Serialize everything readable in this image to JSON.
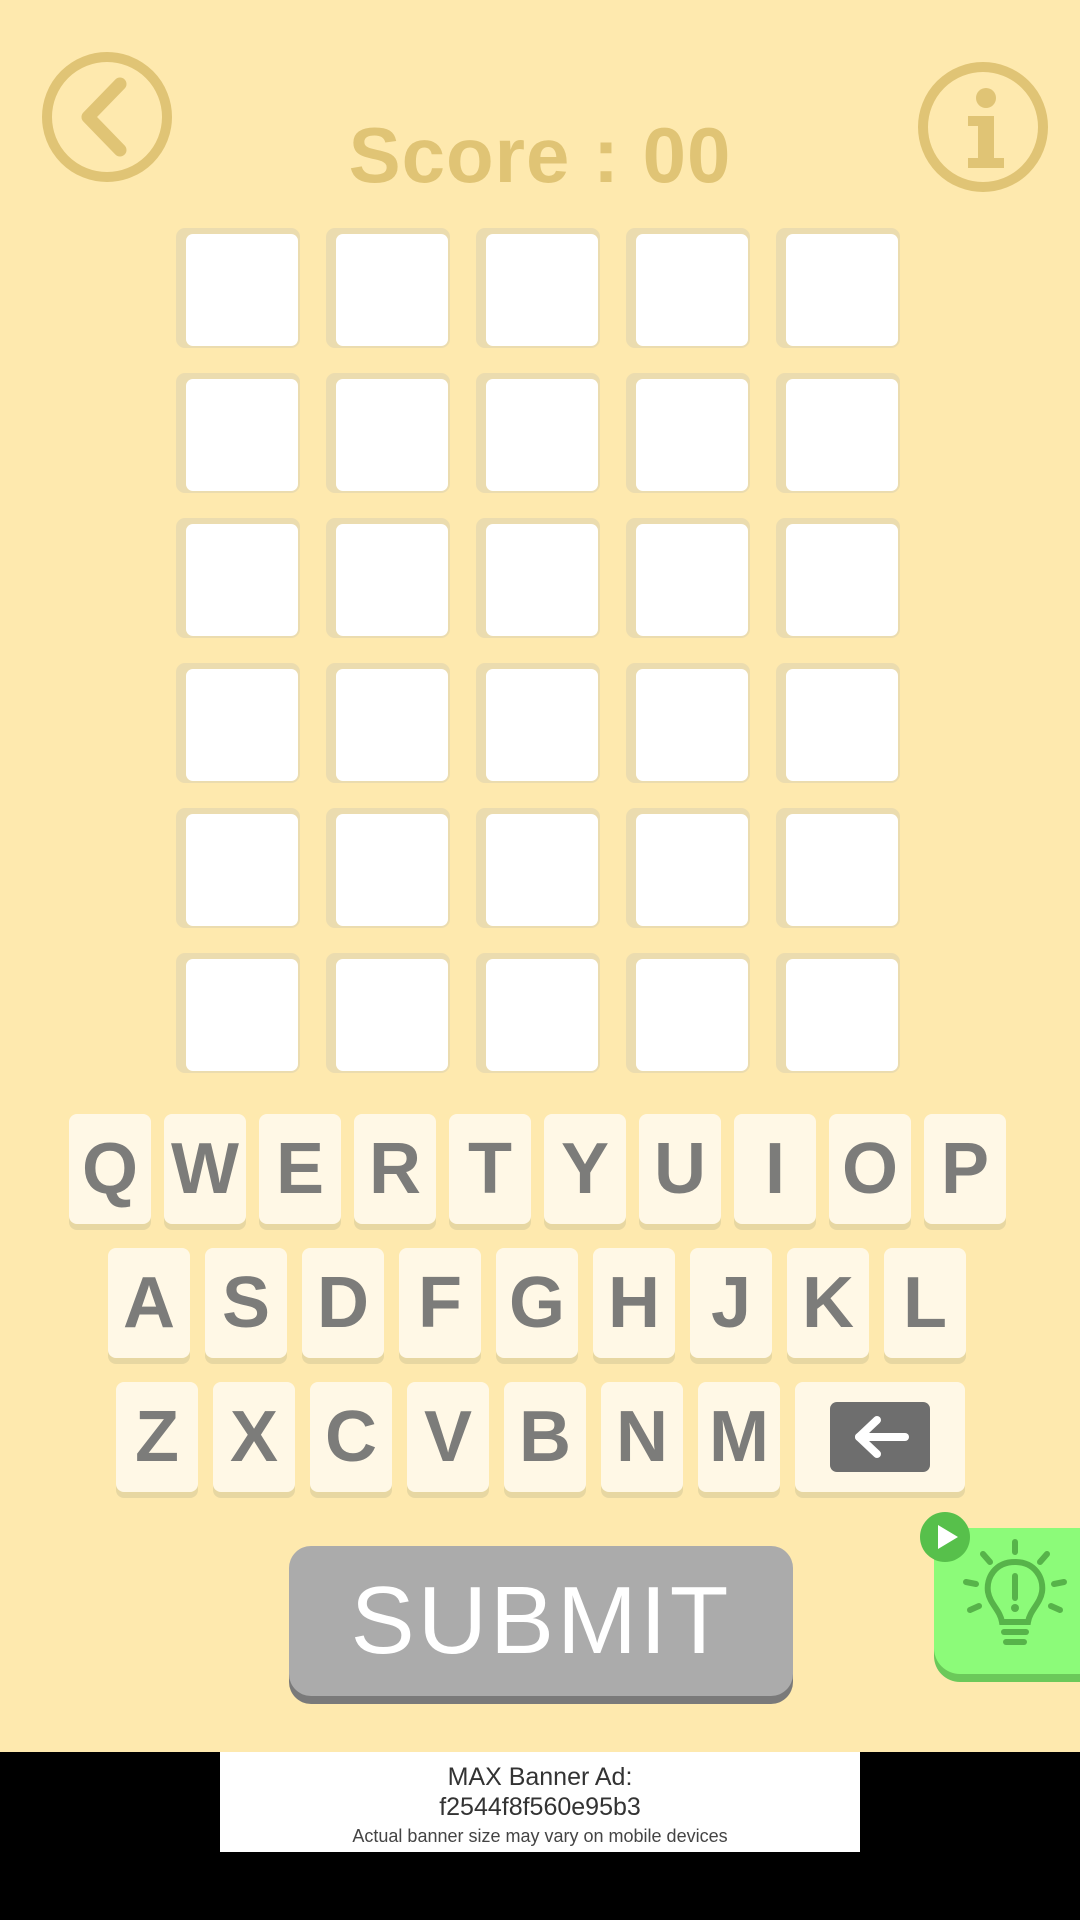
{
  "score": {
    "label": "Score : 00"
  },
  "grid": {
    "rows": 6,
    "cols": 5
  },
  "keyboard": {
    "row1": [
      "Q",
      "W",
      "E",
      "R",
      "T",
      "Y",
      "U",
      "I",
      "O",
      "P"
    ],
    "row2": [
      "A",
      "S",
      "D",
      "F",
      "G",
      "H",
      "J",
      "K",
      "L"
    ],
    "row3": [
      "Z",
      "X",
      "C",
      "V",
      "B",
      "N",
      "M"
    ],
    "backspace_icon": "backspace-arrow-icon"
  },
  "submit": {
    "label": "SUBMIT"
  },
  "hint": {
    "icon": "lightbulb-icon",
    "badge_icon": "play-icon"
  },
  "ad": {
    "title": "MAX Banner Ad:",
    "id": "f2544f8f560e95b3",
    "note": "Actual banner size may vary on mobile devices"
  },
  "colors": {
    "background": "#fee9ae",
    "accent": "#e0c475",
    "key_text": "#7c7c7a",
    "submit": "#ababab",
    "hint": "#8cfb79"
  }
}
